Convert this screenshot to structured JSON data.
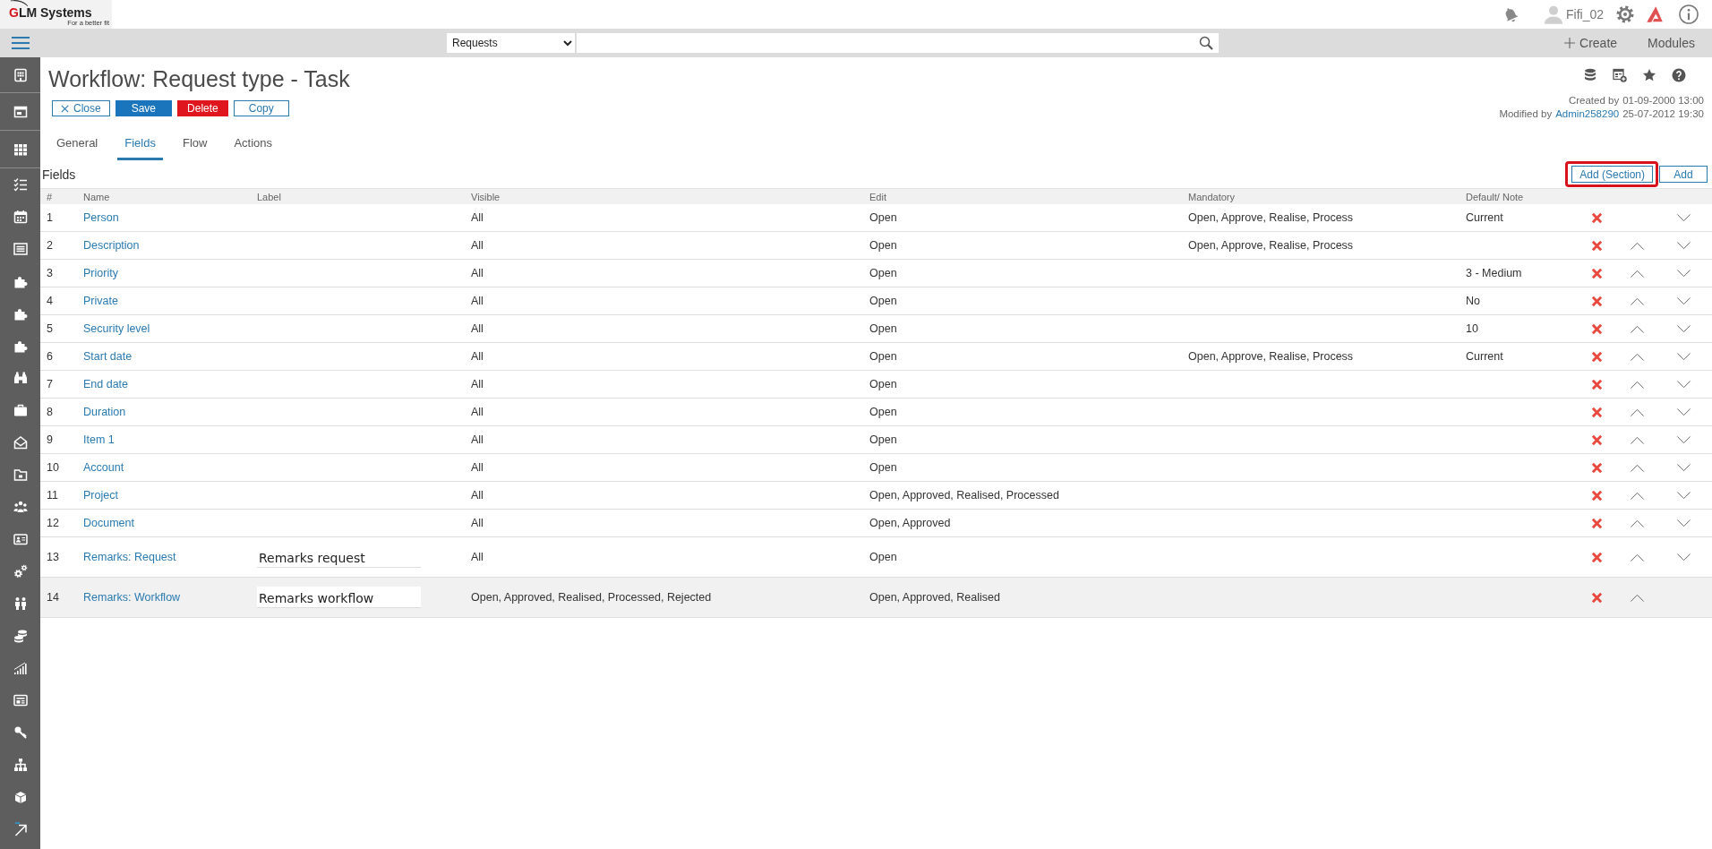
{
  "header": {
    "logo": {
      "name": "GLM Systems",
      "tagline": "For a better fit"
    },
    "user": "Fifi_02"
  },
  "toolbar": {
    "module_select": "Requests",
    "actions": [
      {
        "kind": "create",
        "label": "Create"
      },
      {
        "kind": "plain",
        "label": "Modules"
      }
    ]
  },
  "page": {
    "title": "Workflow: Request type - Task",
    "buttons": [
      {
        "kind": "close",
        "label": "Close"
      },
      {
        "kind": "primary",
        "label": "Save"
      },
      {
        "kind": "danger",
        "label": "Delete"
      },
      {
        "kind": "outline",
        "label": "Copy"
      }
    ],
    "meta": {
      "created": {
        "label": "Created by",
        "date": "01-09-2000 13:00"
      },
      "modified": {
        "label": "Modified by",
        "user": "Admin258290",
        "date": "25-07-2012 19:30"
      }
    }
  },
  "tabs": [
    {
      "label": "General",
      "selected": false
    },
    {
      "label": "Fields",
      "selected": true
    },
    {
      "label": "Flow",
      "selected": false
    },
    {
      "label": "Actions",
      "selected": false
    }
  ],
  "section": {
    "title": "Fields",
    "buttons": [
      {
        "label": "Add (Section)",
        "highlighted": true
      },
      {
        "label": "Add",
        "highlighted": false
      }
    ]
  },
  "table": {
    "columns": [
      "#",
      "Name",
      "Label",
      "Visible",
      "Edit",
      "Mandatory",
      "Default/ Note"
    ],
    "rows": [
      {
        "number": "1",
        "name": "Person",
        "visible": "All",
        "edit": "Open",
        "mandatory": "Open, Approve, Realise, Process",
        "default": "Current",
        "move_up": false,
        "move_down": true,
        "selected": false
      },
      {
        "number": "2",
        "name": "Description",
        "visible": "All",
        "edit": "Open",
        "mandatory": "Open, Approve, Realise, Process",
        "move_up": true,
        "move_down": true,
        "selected": false
      },
      {
        "number": "3",
        "name": "Priority",
        "visible": "All",
        "edit": "Open",
        "default": "3 - Medium",
        "move_up": true,
        "move_down": true,
        "selected": false
      },
      {
        "number": "4",
        "name": "Private",
        "visible": "All",
        "edit": "Open",
        "default": "No",
        "move_up": true,
        "move_down": true,
        "selected": false
      },
      {
        "number": "5",
        "name": "Security level",
        "visible": "All",
        "edit": "Open",
        "default": "10",
        "move_up": true,
        "move_down": true,
        "selected": false
      },
      {
        "number": "6",
        "name": "Start date",
        "visible": "All",
        "edit": "Open",
        "mandatory": "Open, Approve, Realise, Process",
        "default": "Current",
        "move_up": true,
        "move_down": true,
        "selected": false
      },
      {
        "number": "7",
        "name": "End date",
        "visible": "All",
        "edit": "Open",
        "move_up": true,
        "move_down": true,
        "selected": false
      },
      {
        "number": "8",
        "name": "Duration",
        "visible": "All",
        "edit": "Open",
        "move_up": true,
        "move_down": true,
        "selected": false
      },
      {
        "number": "9",
        "name": "Item 1",
        "visible": "All",
        "edit": "Open",
        "move_up": true,
        "move_down": true,
        "selected": false
      },
      {
        "number": "10",
        "name": "Account",
        "visible": "All",
        "edit": "Open",
        "move_up": true,
        "move_down": true,
        "selected": false
      },
      {
        "number": "11",
        "name": "Project",
        "visible": "All",
        "edit": "Open, Approved, Realised, Processed",
        "move_up": true,
        "move_down": true,
        "selected": false
      },
      {
        "number": "12",
        "name": "Document",
        "visible": "All",
        "edit": "Open, Approved",
        "move_up": true,
        "move_down": true,
        "selected": false
      },
      {
        "number": "13",
        "name": "Remarks: Request",
        "label": "Remarks request",
        "visible": "All",
        "edit": "Open",
        "move_up": true,
        "move_down": true,
        "selected": false
      },
      {
        "number": "14",
        "name": "Remarks: Workflow",
        "label": "Remarks workflow",
        "visible": "Open, Approved, Realised, Processed, Rejected",
        "edit": "Open, Approved, Realised",
        "move_up": true,
        "move_down": false,
        "selected": true
      }
    ]
  }
}
